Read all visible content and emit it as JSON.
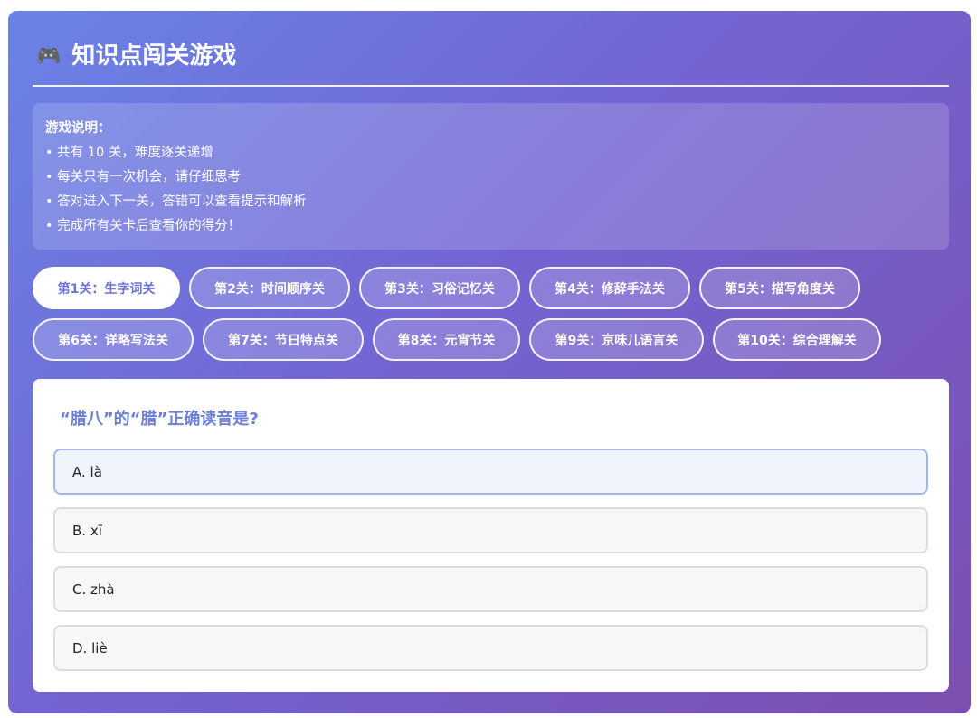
{
  "header": {
    "icon": "gamepad-icon",
    "title": "知识点闯关游戏"
  },
  "instructions": {
    "heading": "游戏说明：",
    "items": [
      "• 共有 10 关，难度逐关递增",
      "• 每关只有一次机会，请仔细思考",
      "• 答对进入下一关，答错可以查看提示和解析",
      "• 完成所有关卡后查看你的得分！"
    ]
  },
  "levels": [
    {
      "label": "第1关：生字词关",
      "active": true
    },
    {
      "label": "第2关：时间顺序关",
      "active": false
    },
    {
      "label": "第3关：习俗记忆关",
      "active": false
    },
    {
      "label": "第4关：修辞手法关",
      "active": false
    },
    {
      "label": "第5关：描写角度关",
      "active": false
    },
    {
      "label": "第6关：详略写法关",
      "active": false
    },
    {
      "label": "第7关：节日特点关",
      "active": false
    },
    {
      "label": "第8关：元宵节关",
      "active": false
    },
    {
      "label": "第9关：京味儿语言关",
      "active": false
    },
    {
      "label": "第10关：综合理解关",
      "active": false
    }
  ],
  "question": {
    "text": "“腊八”的“腊”正确读音是?",
    "options": [
      {
        "label": "A. là"
      },
      {
        "label": "B. xī"
      },
      {
        "label": "C. zhà"
      },
      {
        "label": "D. liè"
      }
    ]
  },
  "colors": {
    "gradient_start": "#6a83e6",
    "gradient_end": "#7b4faf",
    "accent": "#6b72d8",
    "question_text": "#6d7fd6"
  }
}
